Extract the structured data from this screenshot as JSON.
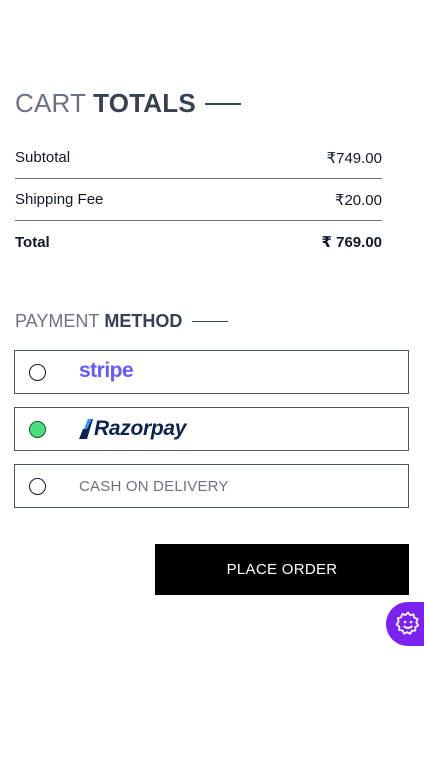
{
  "cart_totals": {
    "title_light": "CART",
    "title_bold": "TOTALS",
    "rows": [
      {
        "label": "Subtotal",
        "value": "₹749.00"
      },
      {
        "label": "Shipping Fee",
        "value": "₹20.00"
      },
      {
        "label": "Total",
        "value": "₹ 769.00"
      }
    ]
  },
  "payment": {
    "title_light": "PAYMENT",
    "title_bold": "METHOD",
    "options": [
      {
        "id": "stripe",
        "label": "stripe",
        "selected": false
      },
      {
        "id": "razorpay",
        "label": "Razorpay",
        "selected": true
      },
      {
        "id": "cod",
        "label": "CASH ON DELIVERY",
        "selected": false
      }
    ]
  },
  "place_order_label": "PLACE ORDER",
  "colors": {
    "accent_purple": "#7c22f0",
    "stripe_brand": "#635bff",
    "razorpay_brand": "#0c2451",
    "razorpay_accent": "#3395ff",
    "selected_radio": "#4ade80",
    "button_bg": "#000000"
  },
  "icons": {
    "floating_button": "gear-smile-icon"
  }
}
